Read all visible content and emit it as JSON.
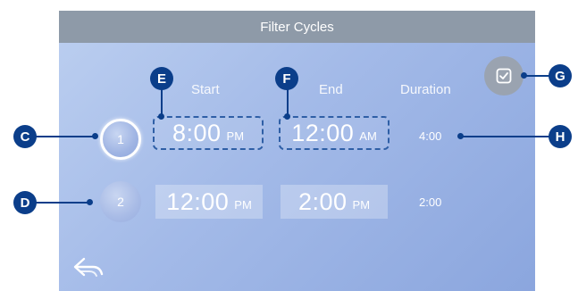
{
  "header": {
    "title": "Filter Cycles"
  },
  "columns": {
    "start": "Start",
    "end": "End",
    "duration": "Duration"
  },
  "cycles": [
    {
      "number": "1",
      "start_time": "8:00",
      "start_ampm": "PM",
      "end_time": "12:00",
      "end_ampm": "AM",
      "duration": "4:00"
    },
    {
      "number": "2",
      "start_time": "12:00",
      "start_ampm": "PM",
      "end_time": "2:00",
      "end_ampm": "PM",
      "duration": "2:00"
    }
  ],
  "callouts": {
    "c": "C",
    "d": "D",
    "e": "E",
    "f": "F",
    "g": "G",
    "h": "H"
  },
  "icons": {
    "save": "check-square-icon",
    "back": "back-arrow-icon"
  },
  "colors": {
    "callout": "#0b3e8a",
    "title_bar": "#8e9aa8",
    "selection_border": "#2f5fa6"
  }
}
